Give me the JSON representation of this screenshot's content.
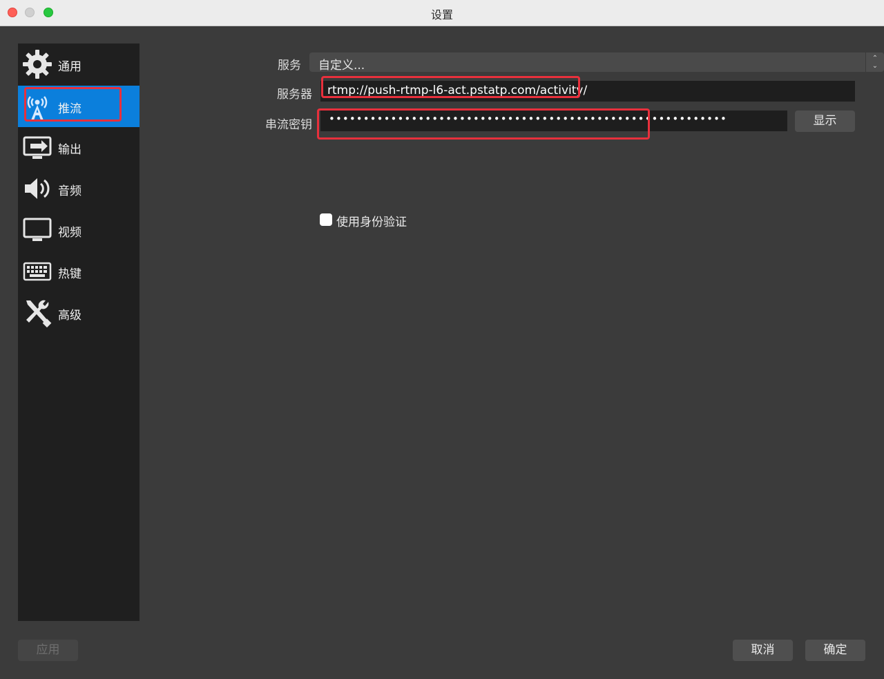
{
  "window": {
    "title": "设置"
  },
  "sidebar": {
    "items": [
      {
        "label": "通用",
        "icon": "gear-icon"
      },
      {
        "label": "推流",
        "icon": "broadcast-tower-icon",
        "active": true
      },
      {
        "label": "输出",
        "icon": "monitor-output-icon"
      },
      {
        "label": "音频",
        "icon": "speaker-icon"
      },
      {
        "label": "视频",
        "icon": "display-icon"
      },
      {
        "label": "热键",
        "icon": "keyboard-icon"
      },
      {
        "label": "高级",
        "icon": "tools-icon"
      }
    ]
  },
  "stream": {
    "service_label": "服务",
    "service_value": "自定义...",
    "server_label": "服务器",
    "server_value": "rtmp://push-rtmp-l6-act.pstatp.com/activity/",
    "key_label": "串流密钥",
    "key_value": "••••••••••••••••••••••••••••••••••••••••••••••••••••••••••",
    "show_button": "显示",
    "auth_checkbox_label": "使用身份验证",
    "auth_checked": false
  },
  "footer": {
    "apply": "应用",
    "cancel": "取消",
    "ok": "确定"
  },
  "colors": {
    "active_nav": "#0b7fdc",
    "highlight_box": "#e8303c",
    "background": "#3b3b3b",
    "sidebar": "#1f1f1f"
  }
}
